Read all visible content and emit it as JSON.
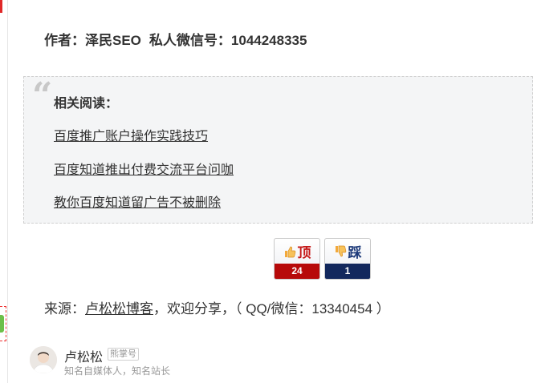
{
  "author_line": {
    "author": "作者：泽民SEO",
    "wechat": "私人微信号：1044248335"
  },
  "related": {
    "title": "相关阅读：",
    "links": [
      "百度推广账户操作实践技巧",
      "百度知道推出付费交流平台问咖",
      "教你百度知道留广告不被删除"
    ]
  },
  "votes": {
    "up": {
      "label": "顶",
      "count": "24",
      "color": "#b70a0a"
    },
    "down": {
      "label": "踩",
      "count": "1",
      "color": "#12285d"
    }
  },
  "source": {
    "prefix": "来源：",
    "link": "卢松松博客",
    "suffix": "，欢迎分享，（ QQ/微信：13340454 ）"
  },
  "author_card": {
    "name": "卢松松",
    "badge": "熊掌号",
    "desc": "知名自媒体人，知名站长"
  }
}
